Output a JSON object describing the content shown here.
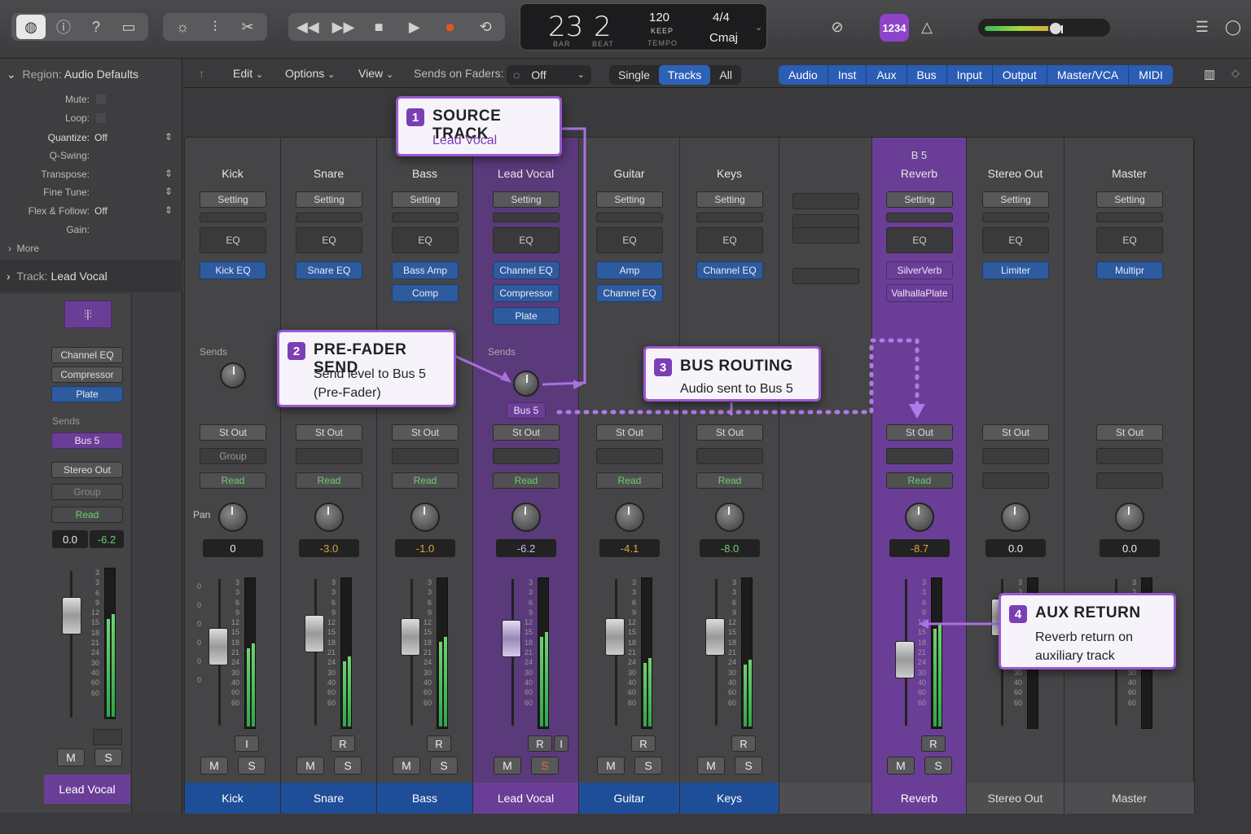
{
  "toolbar": {
    "lcd": {
      "bar": "23",
      "beat": "2",
      "bar_label": "BAR",
      "beat_label": "BEAT",
      "tempo": "120",
      "tempo_mode": "KEEP",
      "tempo_label": "TEMPO",
      "signature": "4/4",
      "key": "Cmaj"
    },
    "count_in": "1234",
    "master_volume_level": 0.62
  },
  "inspector": {
    "region_header": "Region:",
    "region_name": "Audio Defaults",
    "mute_label": "Mute:",
    "loop_label": "Loop:",
    "quantize_label": "Quantize:",
    "quantize_value": "Off",
    "qswing_label": "Q-Swing:",
    "transpose_label": "Transpose:",
    "finetune_label": "Fine Tune:",
    "flex_label": "Flex & Follow:",
    "flex_value": "Off",
    "gain_label": "Gain:",
    "more_label": "More",
    "track_header": "Track:",
    "track_name": "Lead Vocal",
    "plugins": [
      "Channel EQ",
      "Compressor",
      "Plate"
    ],
    "sends_label": "Sends",
    "send": "Bus 5",
    "output": "Stereo Out",
    "group": "Group",
    "automation": "Read",
    "vol": "0.0",
    "pan": "-6.2",
    "mute": "M",
    "solo": "S",
    "strip_name": "Lead Vocal"
  },
  "menubar": {
    "edit": "Edit",
    "options": "Options",
    "view": "View",
    "sends_on_faders": "Sends on Faders:",
    "sends_value": "Off",
    "modes": [
      "Single",
      "Tracks",
      "All"
    ],
    "types": [
      "Audio",
      "Inst",
      "Aux",
      "Bus",
      "Input",
      "Output",
      "Master/VCA",
      "MIDI"
    ]
  },
  "strips": [
    {
      "name": "Kick",
      "setting": "Setting",
      "eq": "EQ",
      "plugins": [
        "Kick EQ"
      ],
      "sends": "Sends",
      "out": "St Out",
      "group": "Group",
      "auto": "Read",
      "pan_label": "Pan",
      "value": "0",
      "m": "M",
      "s": "S",
      "rec": "I"
    },
    {
      "name": "Snare",
      "setting": "Setting",
      "eq": "EQ",
      "plugins": [
        "Snare EQ"
      ],
      "out": "St Out",
      "auto": "Read",
      "value": "-3.0",
      "m": "M",
      "s": "S",
      "rec": "R"
    },
    {
      "name": "Bass",
      "setting": "Setting",
      "eq": "EQ",
      "plugins": [
        "Bass Amp",
        "Comp"
      ],
      "out": "St Out",
      "auto": "Read",
      "value": "-1.0",
      "m": "M",
      "s": "S",
      "rec": "R"
    },
    {
      "name": "Lead Vocal",
      "setting": "Setting",
      "eq": "EQ",
      "plugins": [
        "Channel EQ",
        "Compressor",
        "Plate"
      ],
      "sends": "Sends",
      "send_bus": "Bus 5",
      "out": "St Out",
      "auto": "Read",
      "value": "-6.2",
      "m": "M",
      "s": "S",
      "rec": "R",
      "rec2": "I"
    },
    {
      "name": "Guitar",
      "setting": "Setting",
      "eq": "EQ",
      "plugins": [
        "Amp",
        "Channel EQ"
      ],
      "out": "St Out",
      "auto": "Read",
      "value": "-4.1",
      "m": "M",
      "s": "S",
      "rec": "R"
    },
    {
      "name": "Keys",
      "setting": "Setting",
      "eq": "EQ",
      "plugins": [
        "Channel EQ"
      ],
      "out": "St Out",
      "auto": "Read",
      "value": "-8.0",
      "m": "M",
      "s": "S",
      "rec": "R"
    },
    {
      "name": "Reverb",
      "input": "B 5",
      "setting": "Setting",
      "eq": "EQ",
      "plugins": [
        "SilverVerb",
        "ValhallaPlate"
      ],
      "out": "St Out",
      "auto": "Read",
      "value": "-8.7",
      "m": "M",
      "s": "S",
      "rec": "R"
    },
    {
      "name": "Stereo Out",
      "setting": "Setting",
      "eq": "EQ",
      "plugins": [
        "Limiter"
      ],
      "out": "St Out",
      "value": "0.0"
    },
    {
      "name": "Master",
      "setting": "Setting",
      "eq": "EQ",
      "plugins": [
        "Multipr"
      ],
      "out": "St Out",
      "value": "0.0"
    }
  ],
  "scale_ticks": [
    "3",
    "3",
    "6",
    "9",
    "12",
    "15",
    "18",
    "21",
    "24",
    "30",
    "40",
    "60",
    "60"
  ],
  "left_scale": [
    "0",
    "0",
    "0",
    "0",
    "0",
    "0"
  ],
  "callouts": [
    {
      "num": "1",
      "title": "SOURCE TRACK",
      "line1": "Lead Vocal"
    },
    {
      "num": "2",
      "title": "PRE-FADER SEND",
      "line1": "Send level to Bus 5",
      "line2": "(Pre-Fader)"
    },
    {
      "num": "3",
      "title": "BUS ROUTING",
      "line1": "Audio sent to Bus 5"
    },
    {
      "num": "4",
      "title": "AUX RETURN",
      "line1": "Reverb return on",
      "line2": "auxiliary track"
    }
  ],
  "colors": {
    "accent": "#9b59d0",
    "track_blue": "#1f4e99",
    "selected": "#6a3e96"
  }
}
